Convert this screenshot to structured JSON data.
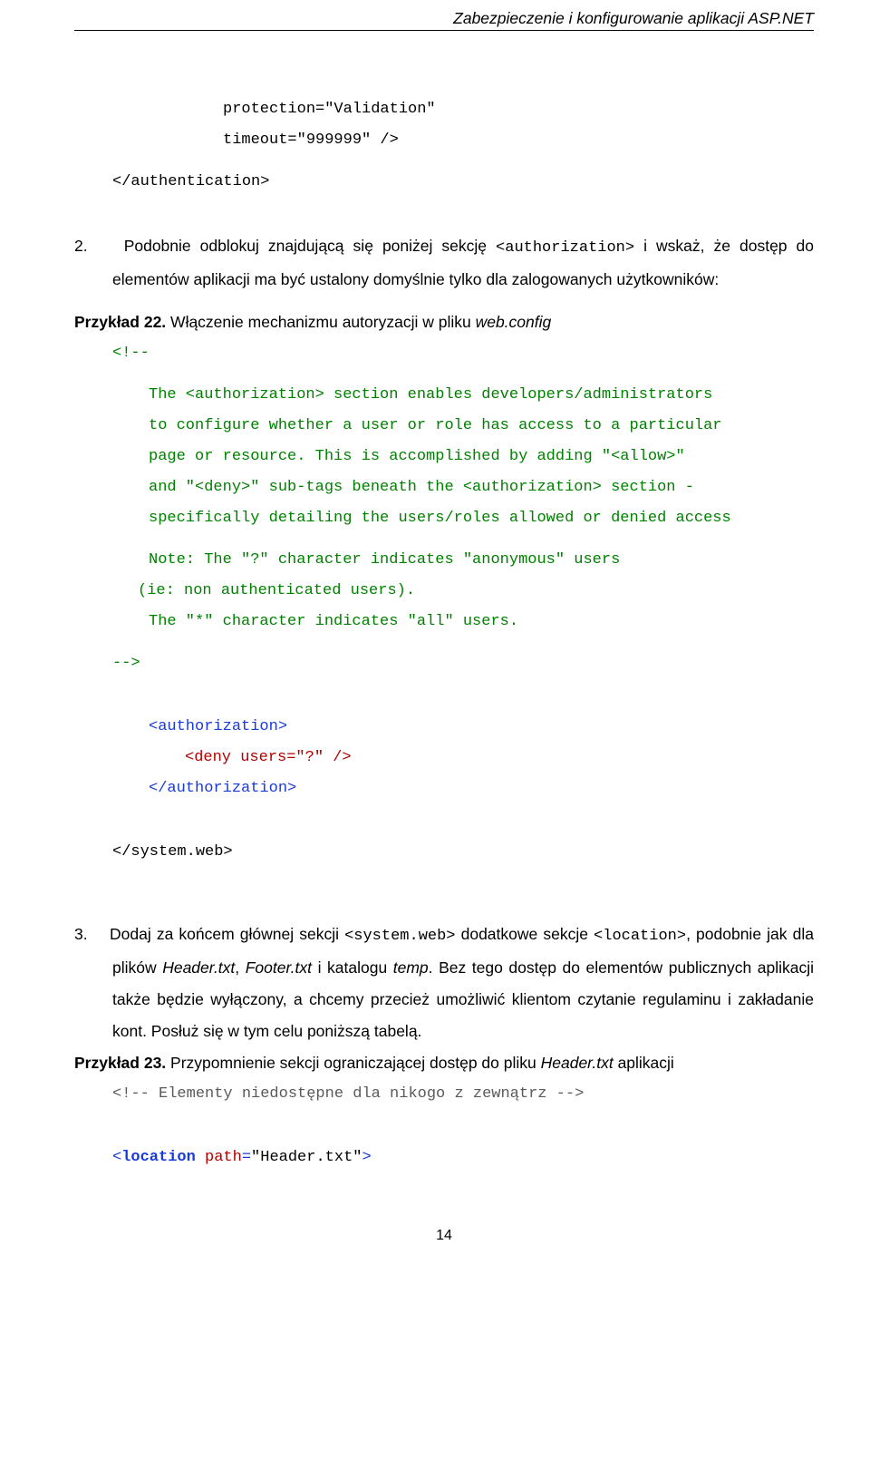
{
  "header": {
    "title": "Zabezpieczenie i konfigurowanie aplikacji ASP.NET"
  },
  "code": {
    "l1": "protection=\"Validation\"",
    "l2": "timeout=\"999999\" />",
    "l3": "</authentication>",
    "open_comment": "<!--",
    "c1": "The <authorization> section enables developers/administrators",
    "c2": "to configure whether a user or role has access to a particular",
    "c3": "page or resource.  This is accomplished by adding \"<allow>\"",
    "c4": "and \"<deny>\" sub-tags beneath the <authorization> section -",
    "c5": "specifically detailing the users/roles allowed or denied access",
    "c6": "Note: The \"?\" character indicates \"anonymous\" users",
    "c7": "(ie: non authenticated users).",
    "c8": "The \"*\" character indicates \"all\" users.",
    "close_comment": "-->",
    "authz_open": "<authorization>",
    "deny": "<deny users=\"?\" />",
    "authz_close": "</authorization>",
    "system_web_close": "</system.web>",
    "inline_c": "<!-- Elementy niedostępne dla nikogo z zewnątrz -->",
    "loc_open_a": "<location",
    "loc_open_attr": "path",
    "loc_open_eq": "=",
    "loc_open_val": "\"Header.txt\"",
    "loc_open_b": ">",
    "authz_inline": "<authorization>",
    "sys_web_inline": "<system.web>",
    "location_inline": "<location>"
  },
  "steps": {
    "s2_num": "2.",
    "s2_a": "Podobnie odblokuj znajdującą się poniżej sekcję ",
    "s2_b": " i wskaż, że dostęp do elementów aplikacji ma być ustalony domyślnie tylko dla zalogowanych użytkowników:",
    "s3_num": "3.",
    "s3_a": "Dodaj za końcem głównej sekcji ",
    "s3_b": " dodatkowe sekcje ",
    "s3_c": ", podobnie jak dla plików ",
    "s3_d": ", ",
    "s3_e": " i katalogu ",
    "s3_f": ". Bez tego dostęp do elementów publicznych aplikacji także będzie wyłączony, a chcemy przecież umożliwić klientom czytanie regulaminu i zakładanie kont. Posłuż się w tym celu poniższą tabelą.",
    "file1": "Header.txt",
    "file2": "Footer.txt",
    "dir1": "temp"
  },
  "examples": {
    "ex22_label": "Przykład 22. ",
    "ex22_text_a": "Włączenie mechanizmu autoryzacji w pliku ",
    "ex22_text_b": "web.config",
    "ex23_label": "Przykład 23. ",
    "ex23_text_a": "Przypomnienie sekcji ograniczającej dostęp do pliku ",
    "ex23_text_b": "Header.txt",
    "ex23_text_c": " aplikacji"
  },
  "footer": {
    "page": "14"
  }
}
